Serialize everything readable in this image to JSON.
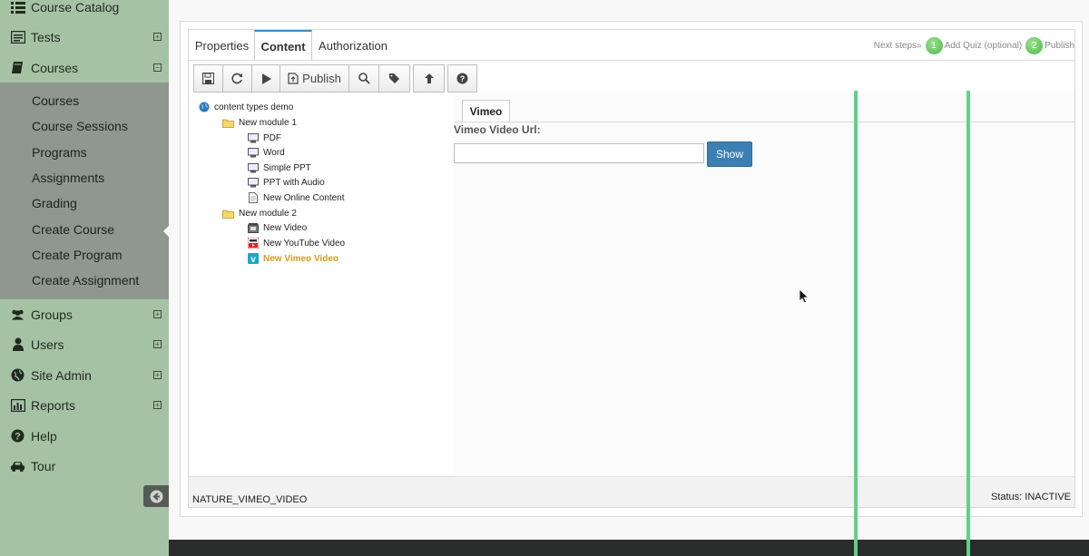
{
  "sidebar": {
    "items": [
      {
        "label": "Course Catalog",
        "icon": "list-icon",
        "expander": ""
      },
      {
        "label": "Tests",
        "icon": "test-icon",
        "expander": "+"
      },
      {
        "label": "Courses",
        "icon": "book-icon",
        "expander": "−"
      },
      {
        "label": "Groups",
        "icon": "group-icon",
        "expander": "+"
      },
      {
        "label": "Users",
        "icon": "user-icon",
        "expander": "+"
      },
      {
        "label": "Site Admin",
        "icon": "globe-icon",
        "expander": "+"
      },
      {
        "label": "Reports",
        "icon": "chart-icon",
        "expander": "+"
      },
      {
        "label": "Help",
        "icon": "question-icon",
        "expander": ""
      },
      {
        "label": "Tour",
        "icon": "car-icon",
        "expander": ""
      }
    ],
    "courses_sub": [
      "Courses",
      "Course Sessions",
      "Programs",
      "Assignments",
      "Grading",
      "Create Course",
      "Create Program",
      "Create Assignment"
    ]
  },
  "tabs": [
    "Properties",
    "Content",
    "Authorization"
  ],
  "next_steps": {
    "label": "Next steps»",
    "step1_num": "1",
    "step1_label": "Add Quiz (optional)",
    "step2_num": "2",
    "step2_label": "Publish"
  },
  "toolbar": {
    "publish_label": "Publish"
  },
  "tree": {
    "root": "content types demo",
    "module1": "New module 1",
    "module1_items": [
      "PDF",
      "Word",
      "Simple PPT",
      "PPT with Audio",
      "New Online Content"
    ],
    "module2": "New module 2",
    "module2_items": [
      "New Video",
      "New YouTube Video",
      "New Vimeo Video"
    ]
  },
  "vimeo": {
    "tab": "Vimeo",
    "url_label": "Vimeo Video Url:",
    "url_value": "",
    "show_button": "Show"
  },
  "status": {
    "code": "NATURE_VIMEO_VIDEO",
    "status": "Status: INACTIVE"
  },
  "colors": {
    "sidebar_bg": "#a6c2a5",
    "subnav_bg": "#8f9790",
    "accent_blue": "#3c7fb5",
    "step_green": "#4eb64a",
    "selected_item": "#d99a16"
  }
}
